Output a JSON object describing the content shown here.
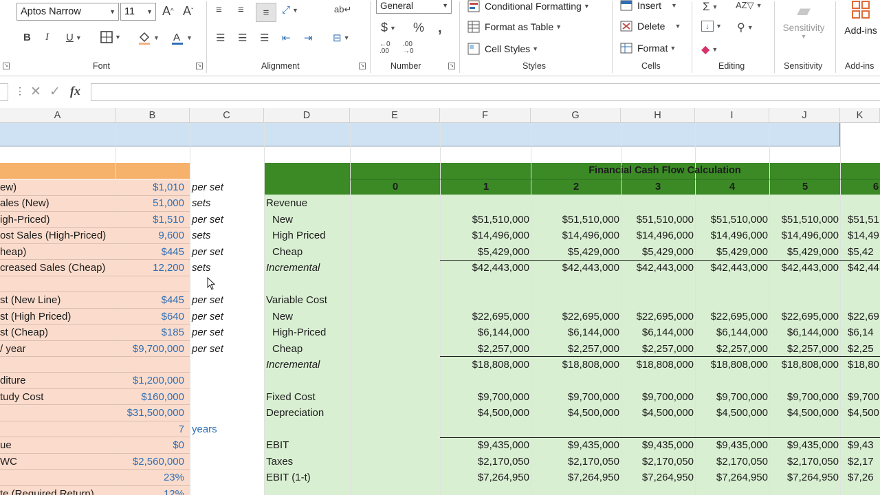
{
  "ribbon": {
    "font_name": "Aptos Narrow",
    "font_size": "11",
    "bold": "B",
    "italic": "I",
    "underline": "U",
    "number_format": "General",
    "conditional_formatting": "Conditional Formatting",
    "format_as_table": "Format as Table",
    "cell_styles": "Cell Styles",
    "insert": "Insert",
    "delete": "Delete",
    "format": "Format",
    "sensitivity_btn": "Sensitivity",
    "addins_btn": "Add-ins",
    "groups": {
      "font": "Font",
      "alignment": "Alignment",
      "number": "Number",
      "styles": "Styles",
      "cells": "Cells",
      "editing": "Editing",
      "sensitivity": "Sensitivity",
      "addins": "Add-ins"
    },
    "accent": "#c0504d"
  },
  "formula_bar": {
    "fx": "fx",
    "content": ""
  },
  "columns": [
    "A",
    "B",
    "C",
    "D",
    "E",
    "F",
    "G",
    "H",
    "I",
    "J",
    "K"
  ],
  "assumptions": [
    {
      "label": "ew)",
      "value": "$1,010",
      "unit": "per set"
    },
    {
      "label": "ales (New)",
      "value": "51,000",
      "unit": "sets"
    },
    {
      "label": "igh-Priced)",
      "value": "$1,510",
      "unit": "per set"
    },
    {
      "label": "ost Sales (High-Priced)",
      "value": "9,600",
      "unit": "sets"
    },
    {
      "label": "heap)",
      "value": "$445",
      "unit": "per set"
    },
    {
      "label": "creased Sales (Cheap)",
      "value": "12,200",
      "unit": "sets"
    },
    {
      "label": "",
      "value": "",
      "unit": ""
    },
    {
      "label": "st (New Line)",
      "value": "$445",
      "unit": "per set"
    },
    {
      "label": "st (High Priced)",
      "value": "$640",
      "unit": "per set"
    },
    {
      "label": "st (Cheap)",
      "value": "$185",
      "unit": "per set"
    },
    {
      "label": " / year",
      "value": "$9,700,000",
      "unit": "per set"
    },
    {
      "label": "",
      "value": "",
      "unit": ""
    },
    {
      "label": "diture",
      "value": "$1,200,000",
      "unit": ""
    },
    {
      "label": "tudy Cost",
      "value": "$160,000",
      "unit": ""
    },
    {
      "label": "",
      "value": "$31,500,000",
      "unit": ""
    },
    {
      "label": "",
      "value": "7",
      "unit": "years"
    },
    {
      "label": "ue",
      "value": "$0",
      "unit": ""
    },
    {
      "label": "WC",
      "value": "$2,560,000",
      "unit": ""
    },
    {
      "label": "",
      "value": "23%",
      "unit": ""
    },
    {
      "label": "te (Required Return)",
      "value": "12%",
      "unit": ""
    }
  ],
  "cashflow": {
    "title": "Financial Cash Flow Calculation",
    "years": [
      "0",
      "1",
      "2",
      "3",
      "4",
      "5",
      "6"
    ],
    "rows": [
      {
        "label": "",
        "values": []
      },
      {
        "label": "Revenue",
        "values": []
      },
      {
        "label": "New",
        "values": [
          "$51,510,000",
          "$51,510,000",
          "$51,510,000",
          "$51,510,000",
          "$51,510,000",
          "$51,51"
        ]
      },
      {
        "label": "High Priced",
        "values": [
          "$14,496,000",
          "$14,496,000",
          "$14,496,000",
          "$14,496,000",
          "$14,496,000",
          "$14,49"
        ]
      },
      {
        "label": "Cheap",
        "values": [
          "$5,429,000",
          "$5,429,000",
          "$5,429,000",
          "$5,429,000",
          "$5,429,000",
          "$5,42"
        ]
      },
      {
        "label": "Incremental",
        "values": [
          "$42,443,000",
          "$42,443,000",
          "$42,443,000",
          "$42,443,000",
          "$42,443,000",
          "$42,44"
        ]
      },
      {
        "label": "",
        "values": []
      },
      {
        "label": "Variable Cost",
        "values": []
      },
      {
        "label": "New",
        "values": [
          "$22,695,000",
          "$22,695,000",
          "$22,695,000",
          "$22,695,000",
          "$22,695,000",
          "$22,69"
        ]
      },
      {
        "label": "High-Priced",
        "values": [
          "$6,144,000",
          "$6,144,000",
          "$6,144,000",
          "$6,144,000",
          "$6,144,000",
          "$6,14"
        ]
      },
      {
        "label": "Cheap",
        "values": [
          "$2,257,000",
          "$2,257,000",
          "$2,257,000",
          "$2,257,000",
          "$2,257,000",
          "$2,25"
        ]
      },
      {
        "label": "Incremental",
        "values": [
          "$18,808,000",
          "$18,808,000",
          "$18,808,000",
          "$18,808,000",
          "$18,808,000",
          "$18,80"
        ]
      },
      {
        "label": "",
        "values": []
      },
      {
        "label": "Fixed Cost",
        "values": [
          "$9,700,000",
          "$9,700,000",
          "$9,700,000",
          "$9,700,000",
          "$9,700,000",
          "$9,700"
        ]
      },
      {
        "label": "Depreciation",
        "values": [
          "$4,500,000",
          "$4,500,000",
          "$4,500,000",
          "$4,500,000",
          "$4,500,000",
          "$4,500"
        ]
      },
      {
        "label": "",
        "values": []
      },
      {
        "label": "EBIT",
        "values": [
          "$9,435,000",
          "$9,435,000",
          "$9,435,000",
          "$9,435,000",
          "$9,435,000",
          "$9,43"
        ]
      },
      {
        "label": "Taxes",
        "values": [
          "$2,170,050",
          "$2,170,050",
          "$2,170,050",
          "$2,170,050",
          "$2,170,050",
          "$2,17"
        ]
      },
      {
        "label": "EBIT (1-t)",
        "values": [
          "$7,264,950",
          "$7,264,950",
          "$7,264,950",
          "$7,264,950",
          "$7,264,950",
          "$7,26"
        ]
      }
    ]
  },
  "colors": {
    "header_green": "#3b8a26",
    "body_green": "#d9efd2",
    "orange_header": "#f6b26b",
    "salmon": "#fbdccc",
    "blue_band": "#cfe2f3",
    "input_blue": "#2f6fb5"
  }
}
